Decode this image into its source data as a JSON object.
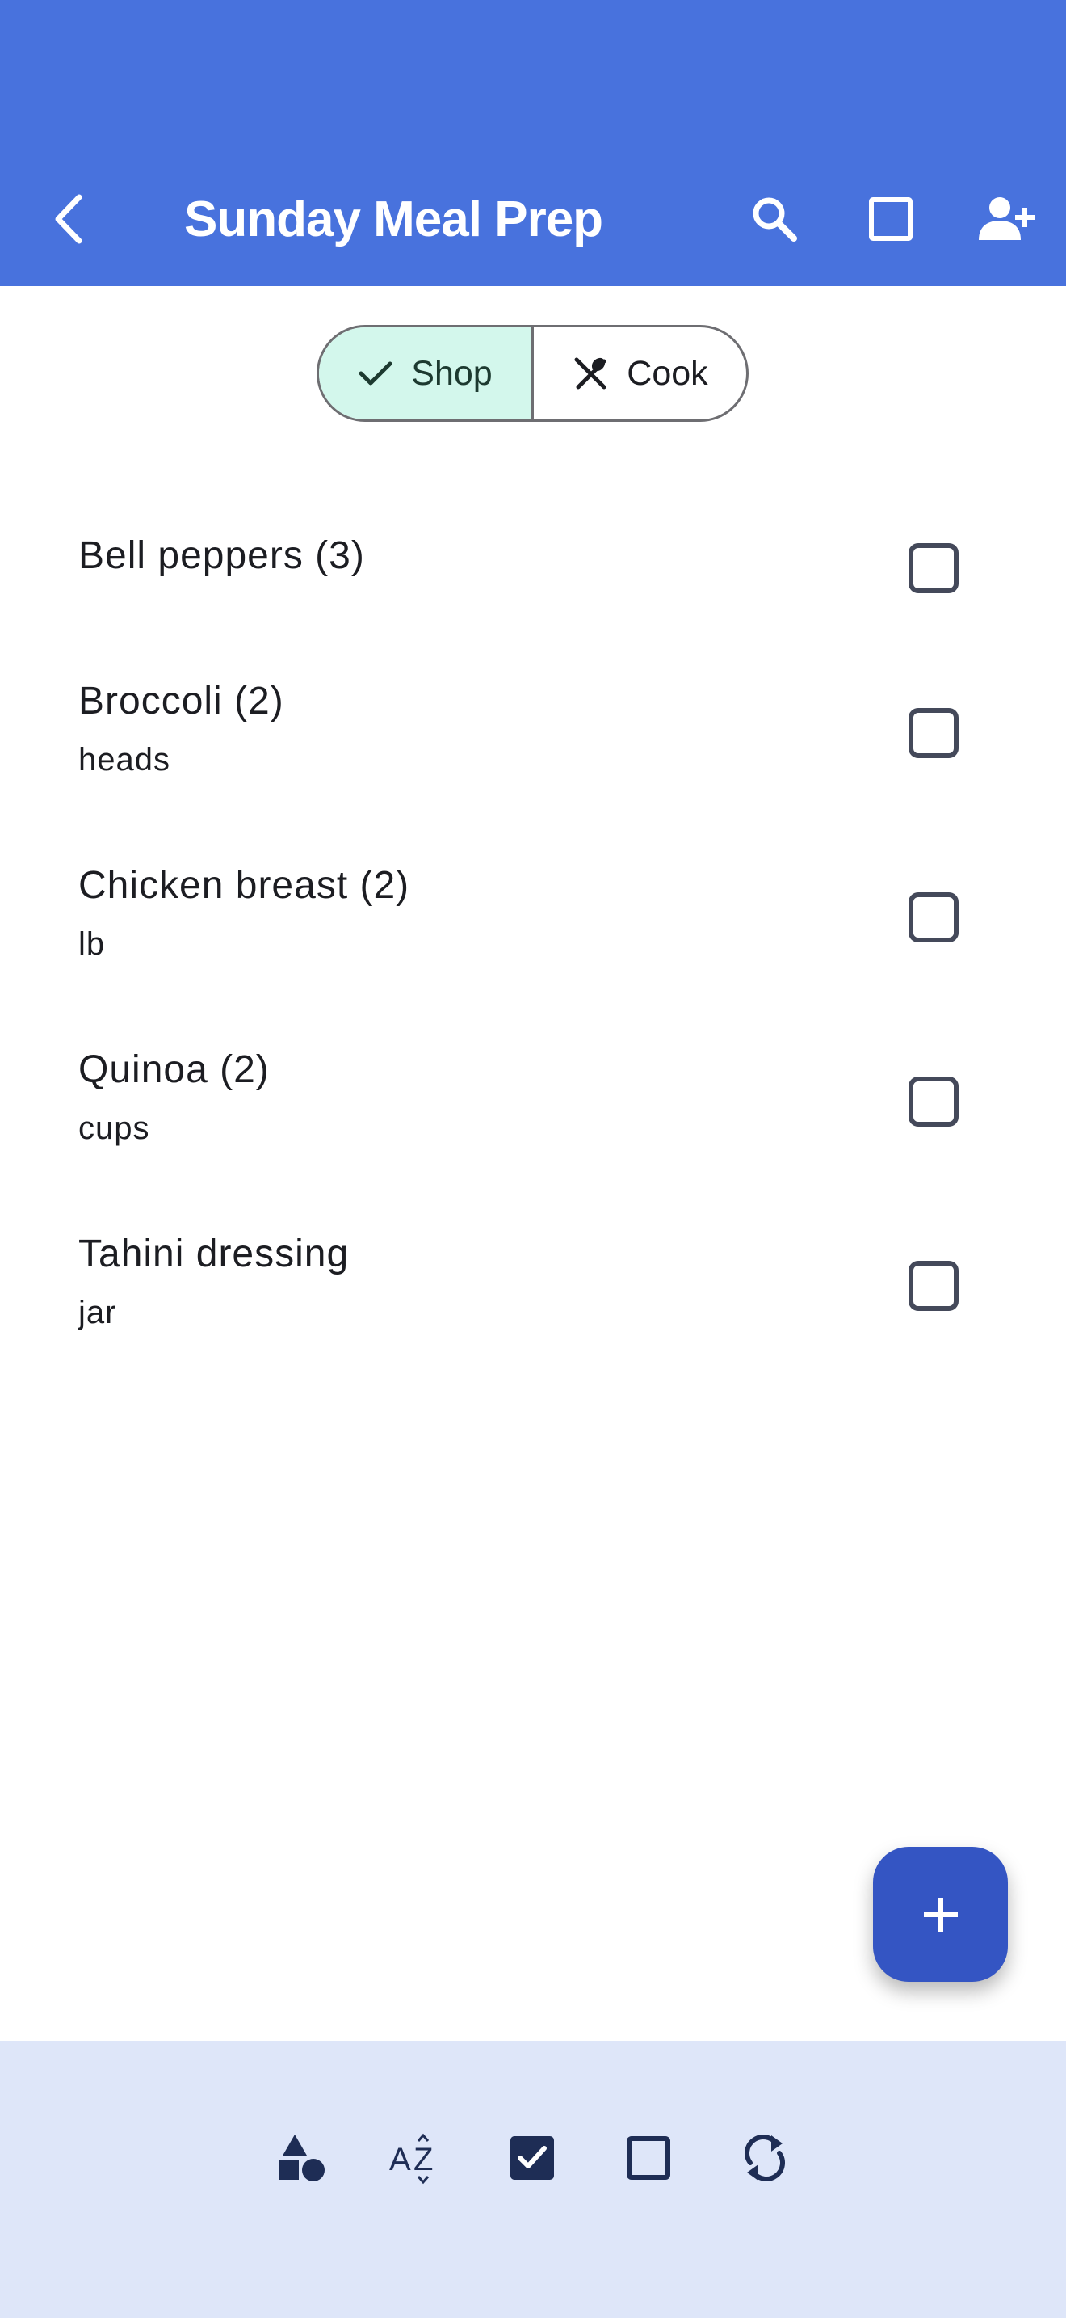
{
  "app_bar": {
    "title": "Sunday Meal Prep",
    "background": "#4872dd",
    "icons": [
      "back-arrow-icon",
      "search-icon",
      "square-outline-icon",
      "add-person-icon"
    ]
  },
  "mode_toggle": {
    "shop_label": "Shop",
    "cook_label": "Cook",
    "selected": "Shop",
    "selected_color": "#d3f7ec"
  },
  "items": [
    {
      "name": "Bell peppers (3)",
      "unit": "",
      "checked": false
    },
    {
      "name": "Broccoli (2)",
      "unit": "heads",
      "checked": false
    },
    {
      "name": "Chicken breast (2)",
      "unit": "lb",
      "checked": false
    },
    {
      "name": "Quinoa (2)",
      "unit": "cups",
      "checked": false
    },
    {
      "name": "Tahini dressing",
      "unit": "jar",
      "checked": false
    }
  ],
  "fab": {
    "icon": "plus-icon",
    "color": "#3455c3"
  },
  "bottom_bar": {
    "background": "#dee6f9",
    "icons": [
      "shapes-icon",
      "sort-az-icon",
      "check-all-icon",
      "uncheck-all-icon",
      "sync-icon"
    ]
  }
}
